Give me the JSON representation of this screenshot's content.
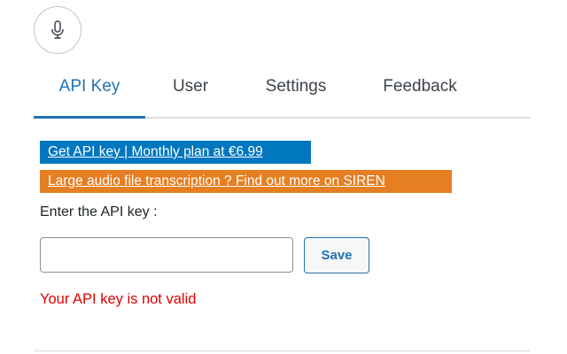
{
  "mic_button": {
    "icon": "microphone-icon"
  },
  "tabs": [
    {
      "label": "API Key",
      "active": true
    },
    {
      "label": "User",
      "active": false
    },
    {
      "label": "Settings",
      "active": false
    },
    {
      "label": "Feedback",
      "active": false
    }
  ],
  "links": {
    "api_plan": "Get API key | Monthly plan at €6.99",
    "siren": "Large audio file transcription ? Find out more on SIREN"
  },
  "api_form": {
    "label": "Enter the API key :",
    "input_value": "",
    "input_placeholder": "",
    "save_label": "Save"
  },
  "status": {
    "error": "Your API key is not valid"
  },
  "colors": {
    "accent": "#2271b1",
    "api_link_bg": "#0077be",
    "siren_link_bg": "#e67e22",
    "error": "#e00000"
  }
}
